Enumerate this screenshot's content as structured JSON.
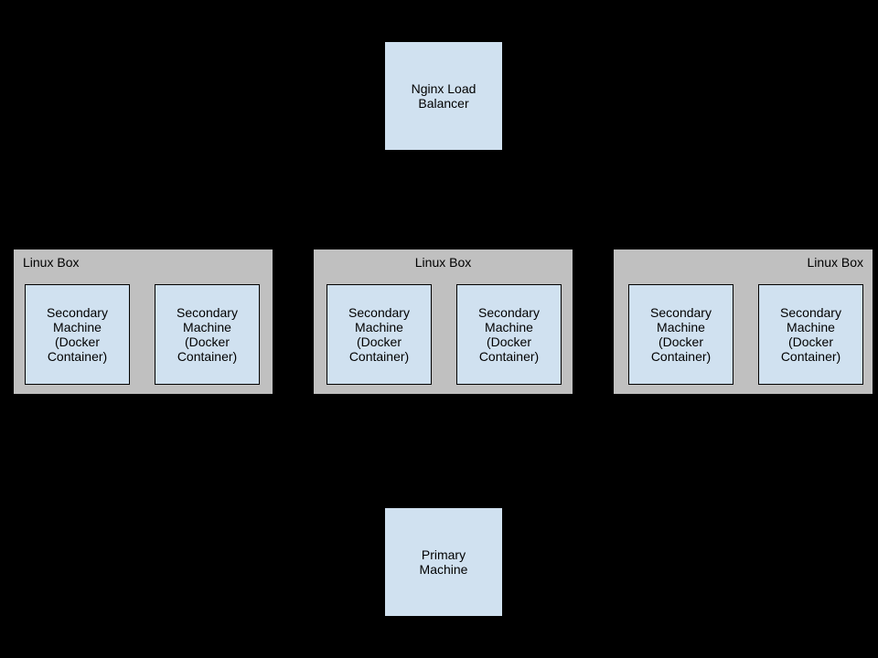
{
  "top": {
    "label": "Nginx Load\nBalancer"
  },
  "linuxBoxes": {
    "title": "Linux Box"
  },
  "secondary": {
    "label": "Secondary\nMachine\n(Docker\nContainer)"
  },
  "primary": {
    "label": "Primary\nMachine"
  },
  "colors": {
    "boxBlue": "#d0e1f0",
    "boxGray": "#c0c0c0",
    "line": "#000000"
  }
}
